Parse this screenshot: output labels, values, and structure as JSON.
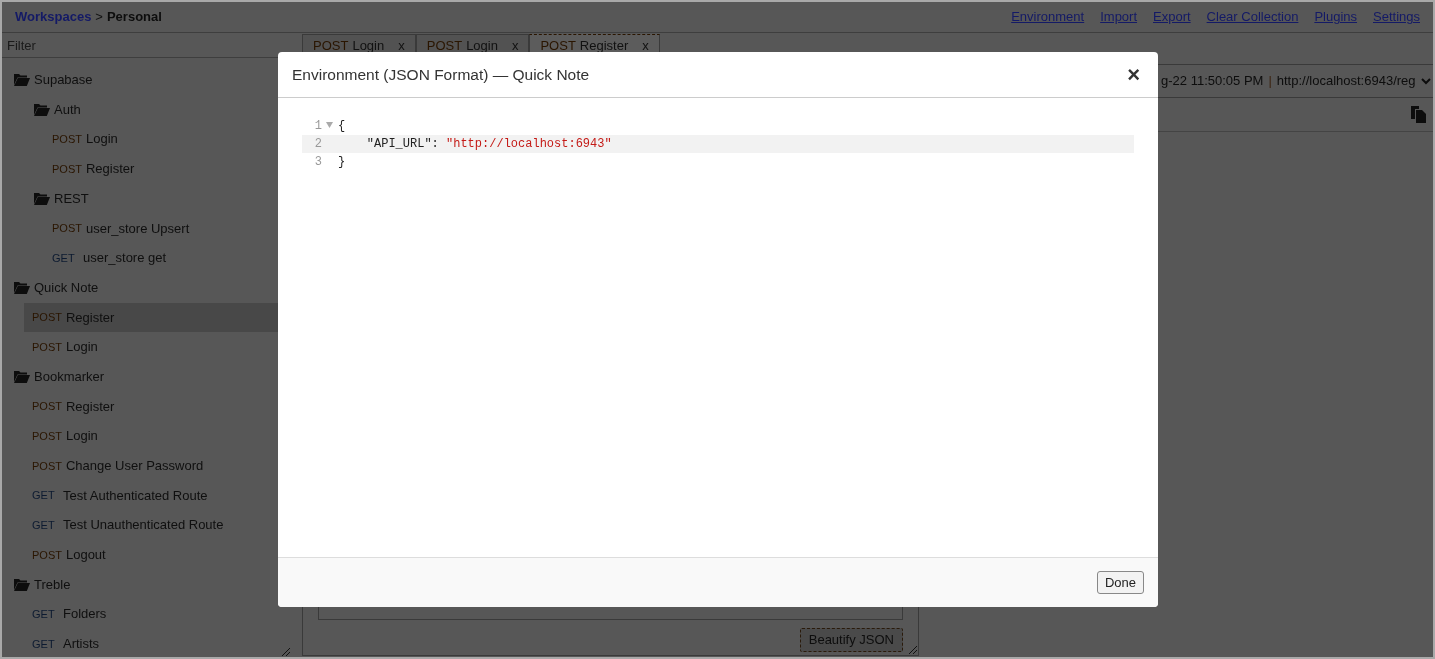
{
  "topbar": {
    "breadcrumb": [
      {
        "kind": "link",
        "text": "Workspaces"
      },
      {
        "kind": "separator",
        "text": ">"
      },
      {
        "kind": "current",
        "text": "Personal"
      }
    ],
    "links": [
      "Environment",
      "Import",
      "Export",
      "Clear Collection",
      "Plugins",
      "Settings"
    ]
  },
  "sidebar": {
    "filter": {
      "placeholder": "Filter"
    },
    "tree": [
      {
        "kind": "folder",
        "label": "Supabase",
        "children": [
          {
            "kind": "folder",
            "label": "Auth",
            "children": [
              {
                "kind": "request",
                "method": "POST",
                "label": "Login",
                "selected": false
              },
              {
                "kind": "request",
                "method": "POST",
                "label": "Register",
                "selected": false
              }
            ]
          },
          {
            "kind": "folder",
            "label": "REST",
            "children": [
              {
                "kind": "request",
                "method": "POST",
                "label": "user_store Upsert",
                "selected": false
              },
              {
                "kind": "request",
                "method": "GET",
                "label": "user_store get",
                "selected": false
              }
            ]
          }
        ]
      },
      {
        "kind": "folder",
        "label": "Quick Note",
        "children": [
          {
            "kind": "request",
            "method": "POST",
            "label": "Register",
            "selected": true
          },
          {
            "kind": "request",
            "method": "POST",
            "label": "Login",
            "selected": false
          }
        ]
      },
      {
        "kind": "folder",
        "label": "Bookmarker",
        "children": [
          {
            "kind": "request",
            "method": "POST",
            "label": "Register",
            "selected": false
          },
          {
            "kind": "request",
            "method": "POST",
            "label": "Login",
            "selected": false
          },
          {
            "kind": "request",
            "method": "POST",
            "label": "Change User Password",
            "selected": false
          },
          {
            "kind": "request",
            "method": "GET",
            "label": "Test Authenticated Route",
            "selected": false
          },
          {
            "kind": "request",
            "method": "GET",
            "label": "Test Unauthenticated Route",
            "selected": false
          },
          {
            "kind": "request",
            "method": "POST",
            "label": "Logout",
            "selected": false
          }
        ]
      },
      {
        "kind": "folder",
        "label": "Treble",
        "children": [
          {
            "kind": "request",
            "method": "GET",
            "label": "Folders",
            "selected": false
          },
          {
            "kind": "request",
            "method": "GET",
            "label": "Artists",
            "selected": false
          }
        ]
      }
    ]
  },
  "tabs": [
    {
      "method": "POST",
      "label": "Login",
      "close": "x",
      "selected": false
    },
    {
      "method": "POST",
      "label": "Login",
      "close": "x",
      "selected": false
    },
    {
      "method": "POST",
      "label": "Register",
      "close": "x",
      "selected": true
    }
  ],
  "request_bar": {
    "timestamp": "g-22 11:50:05 PM",
    "separator": "|",
    "url": "http://localhost:6943/reg"
  },
  "body_panel": {
    "button": "Beautify JSON"
  },
  "dialog": {
    "title": "Environment (JSON Format) — Quick Note",
    "close": "×",
    "lines": [
      {
        "number": "1",
        "foldable": true,
        "active": false,
        "indented": false,
        "tokens": [
          {
            "kind": "punct",
            "text": "{"
          }
        ]
      },
      {
        "number": "2",
        "foldable": false,
        "active": true,
        "indented": true,
        "tokens": [
          {
            "kind": "key",
            "text": "\"API_URL\""
          },
          {
            "kind": "punct",
            "text": ": "
          },
          {
            "kind": "string",
            "text": "\"http://localhost:6943\""
          }
        ]
      },
      {
        "number": "3",
        "foldable": false,
        "active": false,
        "indented": false,
        "tokens": [
          {
            "kind": "punct",
            "text": "}"
          }
        ]
      }
    ],
    "button": "Done"
  }
}
